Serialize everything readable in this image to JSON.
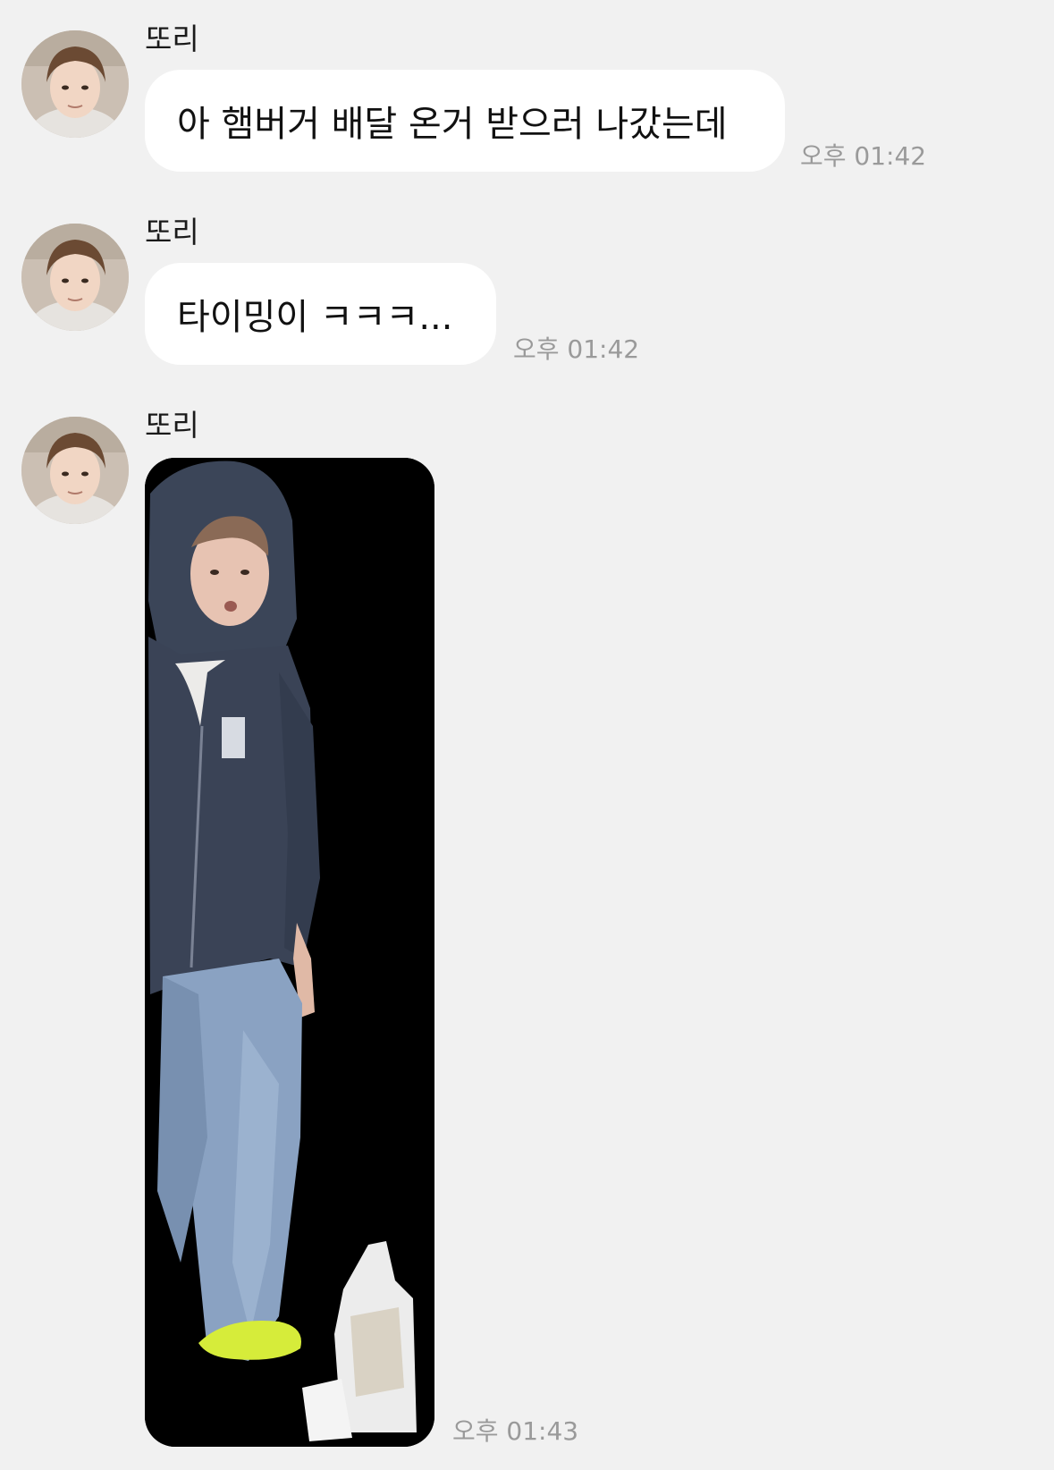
{
  "messages": [
    {
      "sender": "또리",
      "text": "아 햄버거 배달 온거 받으러 나갔는데",
      "time": "오후 01:42"
    },
    {
      "sender": "또리",
      "text": "타이밍이 ㅋㅋㅋ...",
      "time": "오후 01:42"
    },
    {
      "sender": "또리",
      "image": "photo of a person in a navy hoodie and jeans carrying a food delivery bag",
      "time": "오후 01:43"
    }
  ],
  "colors": {
    "background": "#f1f1f1",
    "bubble": "#ffffff",
    "timestamp": "#9a9a9a"
  }
}
